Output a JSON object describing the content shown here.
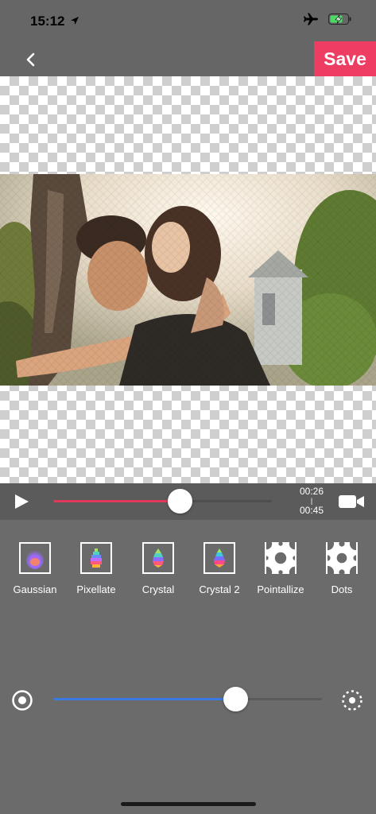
{
  "status": {
    "time": "15:12",
    "icons": [
      "location-arrow-icon",
      "airplane-icon",
      "battery-charging-icon"
    ]
  },
  "nav": {
    "back_icon": "chevron-left-icon",
    "save_label": "Save",
    "save_color": "#ee3d62"
  },
  "player": {
    "current_time": "00:26",
    "separator": "|",
    "total_time": "00:45",
    "progress_fraction": 0.578,
    "progress_color": "#e03a5b",
    "play_icon": "play-icon",
    "camera_icon": "video-camera-icon"
  },
  "filters": [
    {
      "label": "Gaussian",
      "icon": "gaussian-drop-icon"
    },
    {
      "label": "Pixellate",
      "icon": "pixellate-drop-icon"
    },
    {
      "label": "Crystal",
      "icon": "crystal-drop-icon"
    },
    {
      "label": "Crystal 2",
      "icon": "crystal2-drop-icon"
    },
    {
      "label": "Pointallize",
      "icon": "pointillize-icon"
    },
    {
      "label": "Dots",
      "icon": "dots-icon"
    }
  ],
  "intensity": {
    "fraction": 0.678,
    "fill_color": "#3b7ae0",
    "left_icon": "radio-target-icon",
    "right_icon": "dotted-circle-icon"
  }
}
